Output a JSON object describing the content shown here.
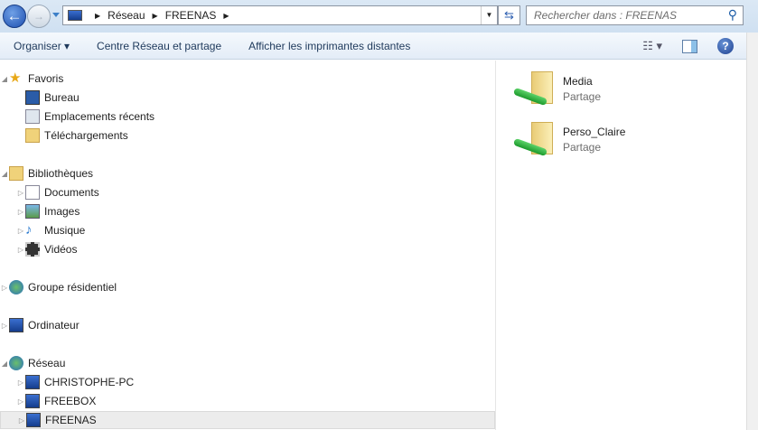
{
  "address": {
    "crumbs": [
      "Réseau",
      "FREENAS"
    ]
  },
  "search": {
    "placeholder": "Rechercher dans : FREENAS"
  },
  "toolbar": {
    "organize": "Organiser ▾",
    "network_center": "Centre Réseau et partage",
    "printers": "Afficher les imprimantes distantes"
  },
  "sidebar": {
    "favorites": {
      "label": "Favoris",
      "items": [
        "Bureau",
        "Emplacements récents",
        "Téléchargements"
      ]
    },
    "libraries": {
      "label": "Bibliothèques",
      "items": [
        "Documents",
        "Images",
        "Musique",
        "Vidéos"
      ]
    },
    "homegroup": "Groupe résidentiel",
    "computer": "Ordinateur",
    "network": {
      "label": "Réseau",
      "items": [
        "CHRISTOPHE-PC",
        "FREEBOX",
        "FREENAS"
      ]
    }
  },
  "content": {
    "items": [
      {
        "name": "Media",
        "type": "Partage"
      },
      {
        "name": "Perso_Claire",
        "type": "Partage"
      }
    ]
  }
}
